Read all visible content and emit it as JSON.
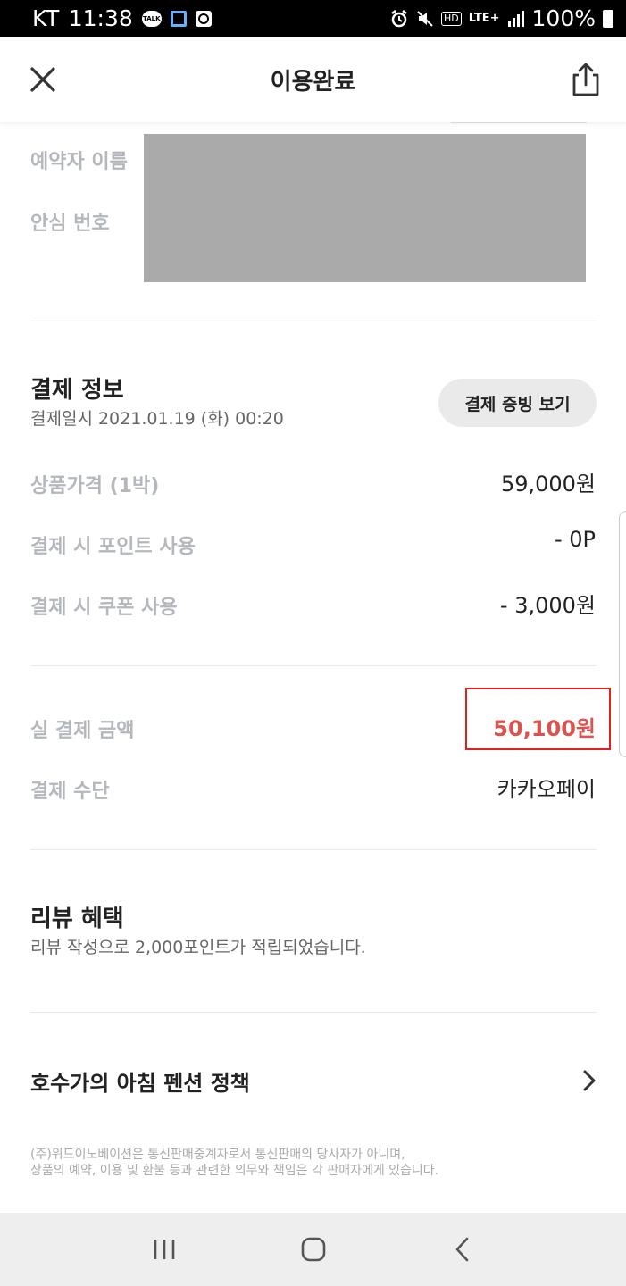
{
  "status_bar": {
    "carrier": "KT",
    "time": "11:38",
    "talk_badge": "TALK",
    "hd": "HD",
    "network": "LTE+",
    "battery": "100%"
  },
  "header": {
    "title": "이용완료"
  },
  "booker": {
    "name_label": "예약자 이름",
    "safe_number_label": "안심 번호"
  },
  "payment": {
    "title": "결제 정보",
    "datetime": "결제일시 2021.01.19 (화) 00:20",
    "proof_button": "결제 증빙 보기",
    "rows": [
      {
        "label": "상품가격 (1박)",
        "value": "59,000원"
      },
      {
        "label": "결제 시 포인트 사용",
        "value": "- 0P"
      },
      {
        "label": "결제 시 쿠폰 사용",
        "value": "- 3,000원"
      }
    ],
    "total_label": "실 결제 금액",
    "total_value": "50,100원",
    "method_label": "결제 수단",
    "method_value": "카카오페이"
  },
  "review": {
    "title": "리뷰 혜택",
    "text": "리뷰 작성으로 2,000포인트가 적립되었습니다."
  },
  "policy": {
    "label": "호수가의 아침 펜션 정책"
  },
  "footnote": {
    "line1": "(주)위드이노베이션은 통신판매중계자로서 통신판매의 당사자가 아니며,",
    "line2": "상품의 예약, 이용 및 환불 등과 관련한 의무와 책임은 각 판매자에게 있습니다."
  },
  "colors": {
    "accent_total": "#d9534f",
    "highlight_border": "#e0201a",
    "muted_label": "#b4b8bd"
  }
}
